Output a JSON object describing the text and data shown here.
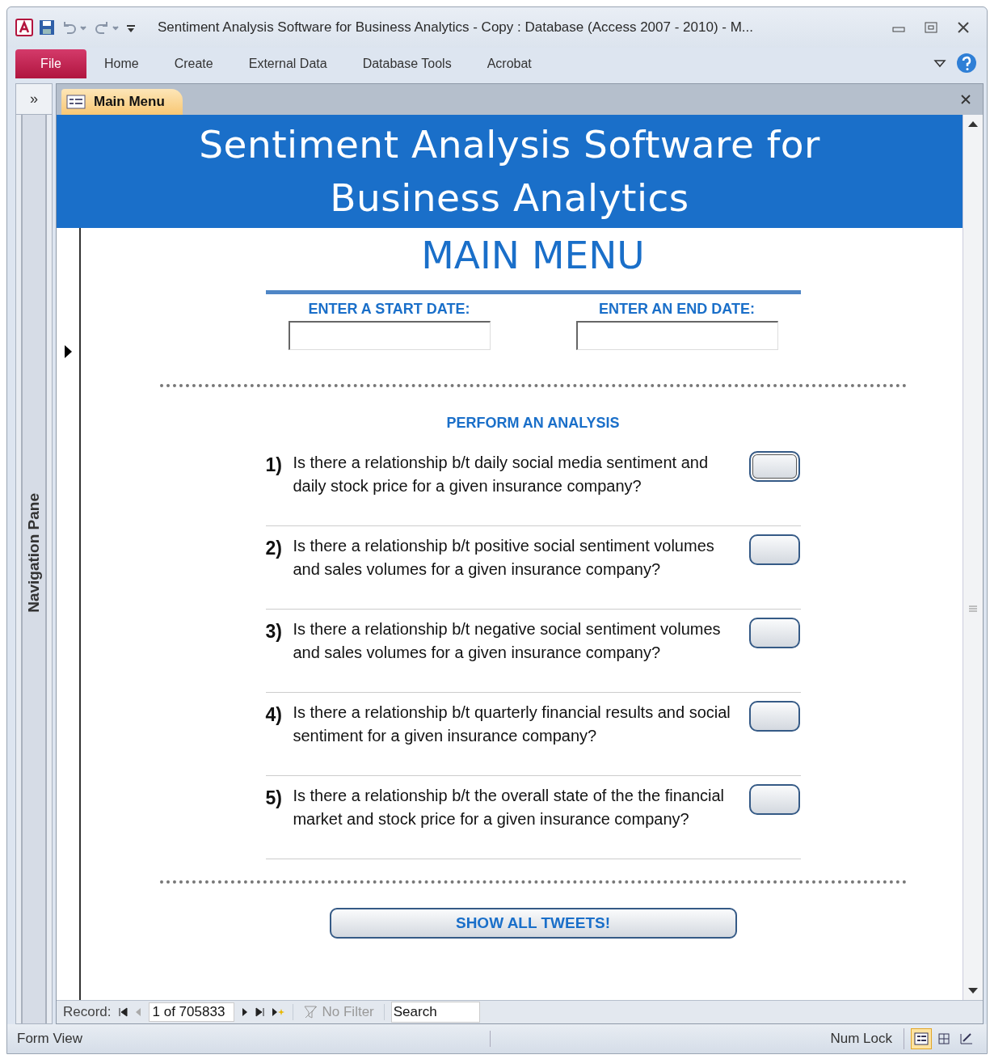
{
  "window": {
    "title": "Sentiment Analysis Software for Business Analytics - Copy : Database (Access 2007 - 2010)  -  M..."
  },
  "ribbon": {
    "file": "File",
    "tabs": [
      {
        "label": "Home",
        "selected": false
      },
      {
        "label": "Create",
        "selected": false
      },
      {
        "label": "External Data",
        "selected": false
      },
      {
        "label": "Database Tools",
        "selected": false
      },
      {
        "label": "Acrobat",
        "selected": false
      }
    ]
  },
  "navigation_pane": {
    "toggle": "»",
    "label": "Navigation Pane"
  },
  "document_tab": {
    "label": "Main Menu",
    "selected": true
  },
  "form": {
    "header": "Sentiment Analysis Software for Business Analytics",
    "title": "MAIN MENU",
    "date_fields": [
      {
        "label": "ENTER A START DATE:"
      },
      {
        "label": "ENTER AN END DATE:"
      }
    ],
    "section_title": "PERFORM AN ANALYSIS",
    "questions": [
      {
        "number": "1)",
        "text": "Is there a relationship b/t daily social media sentiment and daily stock price for a given insurance company?",
        "focused": true
      },
      {
        "number": "2)",
        "text": "Is there a relationship b/t positive social sentiment volumes and sales volumes for a given insurance company?",
        "focused": false
      },
      {
        "number": "3)",
        "text": "Is there a relationship b/t negative social sentiment volumes and sales volumes for a given insurance company?",
        "focused": false
      },
      {
        "number": "4)",
        "text": "Is there a relationship b/t quarterly financial results and social sentiment for a given insurance company?",
        "focused": false
      },
      {
        "number": "5)",
        "text": "Is there a relationship b/t the overall state of the the financial market and stock price for a given insurance company?",
        "focused": false
      }
    ],
    "show_all_button": "SHOW ALL TWEETS!"
  },
  "record_navigation": {
    "label": "Record:",
    "current": "1 of 705833",
    "filter": "No Filter",
    "filter_disabled": true,
    "search": {
      "placeholder": "Search"
    }
  },
  "status_bar": {
    "view": "Form View",
    "num_lock": "Num Lock",
    "views": [
      {
        "kind": "form",
        "selected": true
      },
      {
        "kind": "layout",
        "selected": false
      },
      {
        "kind": "design",
        "selected": false
      }
    ]
  }
}
